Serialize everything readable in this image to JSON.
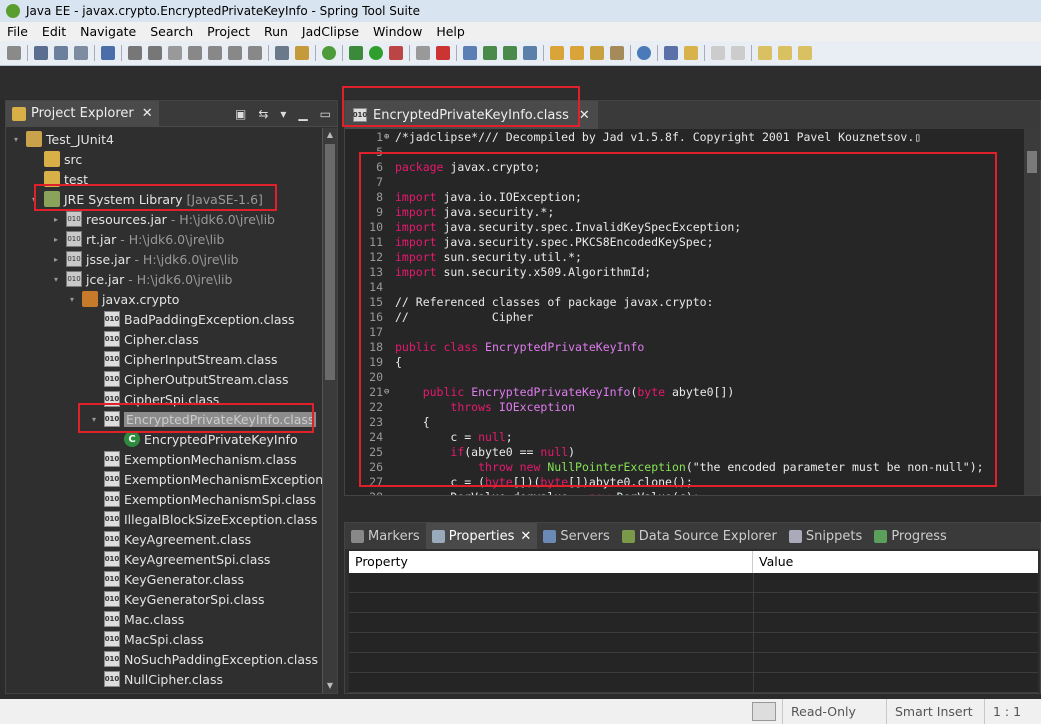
{
  "window": {
    "title": "Java EE - javax.crypto.EncryptedPrivateKeyInfo - Spring Tool Suite"
  },
  "menu": [
    "File",
    "Edit",
    "Navigate",
    "Search",
    "Project",
    "Run",
    "JadClipse",
    "Window",
    "Help"
  ],
  "explorer": {
    "tab_label": "Project Explorer",
    "tree": [
      {
        "label": "Test_JUnit4",
        "sub": "",
        "icon": "project-icon",
        "indent": 0,
        "twisty": "▾"
      },
      {
        "label": "src",
        "sub": "",
        "icon": "folder-icon",
        "indent": 1,
        "twisty": ""
      },
      {
        "label": "test",
        "sub": "",
        "icon": "folder-icon",
        "indent": 1,
        "twisty": ""
      },
      {
        "label": "JRE System Library",
        "sub": "[JavaSE-1.6]",
        "icon": "library-icon",
        "indent": 1,
        "twisty": "▾"
      },
      {
        "label": "resources.jar",
        "sub": "- H:\\jdk6.0\\jre\\lib",
        "icon": "jar-icon",
        "indent": 2,
        "twisty": "▸"
      },
      {
        "label": "rt.jar",
        "sub": "- H:\\jdk6.0\\jre\\lib",
        "icon": "jar-icon",
        "indent": 2,
        "twisty": "▸"
      },
      {
        "label": "jsse.jar",
        "sub": "- H:\\jdk6.0\\jre\\lib",
        "icon": "jar-icon",
        "indent": 2,
        "twisty": "▸"
      },
      {
        "label": "jce.jar",
        "sub": "- H:\\jdk6.0\\jre\\lib",
        "icon": "jar-icon",
        "indent": 2,
        "twisty": "▾"
      },
      {
        "label": "javax.crypto",
        "sub": "",
        "icon": "package-icon",
        "indent": 3,
        "twisty": "▾"
      },
      {
        "label": "BadPaddingException.class",
        "sub": "",
        "icon": "class-file-icon",
        "indent": 4,
        "twisty": ""
      },
      {
        "label": "Cipher.class",
        "sub": "",
        "icon": "class-file-icon",
        "indent": 4,
        "twisty": ""
      },
      {
        "label": "CipherInputStream.class",
        "sub": "",
        "icon": "class-file-icon",
        "indent": 4,
        "twisty": ""
      },
      {
        "label": "CipherOutputStream.class",
        "sub": "",
        "icon": "class-file-icon",
        "indent": 4,
        "twisty": ""
      },
      {
        "label": "CipherSpi.class",
        "sub": "",
        "icon": "class-file-icon",
        "indent": 4,
        "twisty": ""
      },
      {
        "label": "EncryptedPrivateKeyInfo.class",
        "sub": "",
        "icon": "class-file-icon",
        "indent": 4,
        "twisty": "▾",
        "selected": true
      },
      {
        "label": "EncryptedPrivateKeyInfo",
        "sub": "",
        "icon": "class-icon",
        "indent": 5,
        "twisty": ""
      },
      {
        "label": "ExemptionMechanism.class",
        "sub": "",
        "icon": "class-file-icon",
        "indent": 4,
        "twisty": ""
      },
      {
        "label": "ExemptionMechanismException.cla",
        "sub": "",
        "icon": "class-file-icon",
        "indent": 4,
        "twisty": ""
      },
      {
        "label": "ExemptionMechanismSpi.class",
        "sub": "",
        "icon": "class-file-icon",
        "indent": 4,
        "twisty": ""
      },
      {
        "label": "IllegalBlockSizeException.class",
        "sub": "",
        "icon": "class-file-icon",
        "indent": 4,
        "twisty": ""
      },
      {
        "label": "KeyAgreement.class",
        "sub": "",
        "icon": "class-file-icon",
        "indent": 4,
        "twisty": ""
      },
      {
        "label": "KeyAgreementSpi.class",
        "sub": "",
        "icon": "class-file-icon",
        "indent": 4,
        "twisty": ""
      },
      {
        "label": "KeyGenerator.class",
        "sub": "",
        "icon": "class-file-icon",
        "indent": 4,
        "twisty": ""
      },
      {
        "label": "KeyGeneratorSpi.class",
        "sub": "",
        "icon": "class-file-icon",
        "indent": 4,
        "twisty": ""
      },
      {
        "label": "Mac.class",
        "sub": "",
        "icon": "class-file-icon",
        "indent": 4,
        "twisty": ""
      },
      {
        "label": "MacSpi.class",
        "sub": "",
        "icon": "class-file-icon",
        "indent": 4,
        "twisty": ""
      },
      {
        "label": "NoSuchPaddingException.class",
        "sub": "",
        "icon": "class-file-icon",
        "indent": 4,
        "twisty": ""
      },
      {
        "label": "NullCipher.class",
        "sub": "",
        "icon": "class-file-icon",
        "indent": 4,
        "twisty": ""
      }
    ]
  },
  "editor": {
    "tab_label": "EncryptedPrivateKeyInfo.class",
    "lines": [
      {
        "n": "1",
        "fold": "+",
        "parts": [
          [
            "cm",
            "/*jadclipse*/// Decompiled by Jad v1.5.8f. Copyright 2001 Pavel Kouznetsov.▯"
          ]
        ]
      },
      {
        "n": "5",
        "fold": "",
        "parts": []
      },
      {
        "n": "6",
        "fold": "",
        "parts": [
          [
            "kw",
            "package"
          ],
          [
            "pl",
            " javax.crypto;"
          ]
        ]
      },
      {
        "n": "7",
        "fold": "",
        "parts": []
      },
      {
        "n": "8",
        "fold": "",
        "parts": [
          [
            "kw",
            "import"
          ],
          [
            "pl",
            " java.io.IOException;"
          ]
        ]
      },
      {
        "n": "9",
        "fold": "",
        "parts": [
          [
            "kw",
            "import"
          ],
          [
            "pl",
            " java.security.*;"
          ]
        ]
      },
      {
        "n": "10",
        "fold": "",
        "parts": [
          [
            "kw",
            "import"
          ],
          [
            "pl",
            " java.security.spec.InvalidKeySpecException;"
          ]
        ]
      },
      {
        "n": "11",
        "fold": "",
        "parts": [
          [
            "kw",
            "import"
          ],
          [
            "pl",
            " java.security.spec.PKCS8EncodedKeySpec;"
          ]
        ]
      },
      {
        "n": "12",
        "fold": "",
        "parts": [
          [
            "kw",
            "import"
          ],
          [
            "pl",
            " sun.security.util.*;"
          ]
        ]
      },
      {
        "n": "13",
        "fold": "",
        "parts": [
          [
            "kw",
            "import"
          ],
          [
            "pl",
            " sun.security.x509.AlgorithmId;"
          ]
        ]
      },
      {
        "n": "14",
        "fold": "",
        "parts": []
      },
      {
        "n": "15",
        "fold": "",
        "parts": [
          [
            "cm",
            "// Referenced classes of package javax.crypto:"
          ]
        ]
      },
      {
        "n": "16",
        "fold": "",
        "parts": [
          [
            "cm",
            "//            Cipher"
          ]
        ]
      },
      {
        "n": "17",
        "fold": "",
        "parts": []
      },
      {
        "n": "18",
        "fold": "",
        "parts": [
          [
            "kw",
            "public class"
          ],
          [
            "pl",
            " "
          ],
          [
            "cls",
            "EncryptedPrivateKeyInfo"
          ]
        ]
      },
      {
        "n": "19",
        "fold": "",
        "parts": [
          [
            "pl",
            "{"
          ]
        ]
      },
      {
        "n": "20",
        "fold": "",
        "parts": []
      },
      {
        "n": "21",
        "fold": "-",
        "parts": [
          [
            "pl",
            "    "
          ],
          [
            "kw",
            "public"
          ],
          [
            "pl",
            " "
          ],
          [
            "cls",
            "EncryptedPrivateKeyInfo"
          ],
          [
            "pl",
            "("
          ],
          [
            "kw",
            "byte"
          ],
          [
            "pl",
            " abyte0[])"
          ]
        ]
      },
      {
        "n": "22",
        "fold": "",
        "parts": [
          [
            "pl",
            "        "
          ],
          [
            "kw",
            "throws"
          ],
          [
            "pl",
            " "
          ],
          [
            "cls",
            "IOException"
          ]
        ]
      },
      {
        "n": "23",
        "fold": "",
        "parts": [
          [
            "pl",
            "    {"
          ]
        ]
      },
      {
        "n": "24",
        "fold": "",
        "parts": [
          [
            "pl",
            "        c = "
          ],
          [
            "kw",
            "null"
          ],
          [
            "pl",
            ";"
          ]
        ]
      },
      {
        "n": "25",
        "fold": "",
        "parts": [
          [
            "pl",
            "        "
          ],
          [
            "kw",
            "if"
          ],
          [
            "pl",
            "(abyte0 == "
          ],
          [
            "kw",
            "null"
          ],
          [
            "pl",
            ")"
          ]
        ]
      },
      {
        "n": "26",
        "fold": "",
        "parts": [
          [
            "pl",
            "            "
          ],
          [
            "kw",
            "throw new"
          ],
          [
            "pl",
            " "
          ],
          [
            "str",
            "NullPointerException"
          ],
          [
            "pl",
            "(\"the encoded parameter must be non-null\");"
          ]
        ]
      },
      {
        "n": "27",
        "fold": "",
        "parts": [
          [
            "pl",
            "        c = ("
          ],
          [
            "kw",
            "byte"
          ],
          [
            "pl",
            "[])("
          ],
          [
            "kw",
            "byte"
          ],
          [
            "pl",
            "[])abyte0.clone();"
          ]
        ]
      },
      {
        "n": "28",
        "fold": "",
        "parts": [
          [
            "pl",
            "        DerValue dervalue = "
          ],
          [
            "kw",
            "new"
          ],
          [
            "pl",
            " DerValue(c);"
          ]
        ]
      }
    ]
  },
  "bottom": {
    "tabs": [
      {
        "label": "Markers",
        "active": false
      },
      {
        "label": "Properties",
        "active": true
      },
      {
        "label": "Servers",
        "active": false
      },
      {
        "label": "Data Source Explorer",
        "active": false
      },
      {
        "label": "Snippets",
        "active": false
      },
      {
        "label": "Progress",
        "active": false
      }
    ],
    "columns": [
      "Property",
      "Value"
    ]
  },
  "status": {
    "mode": "Read-Only",
    "insert": "Smart Insert",
    "position": "1 : 1"
  }
}
